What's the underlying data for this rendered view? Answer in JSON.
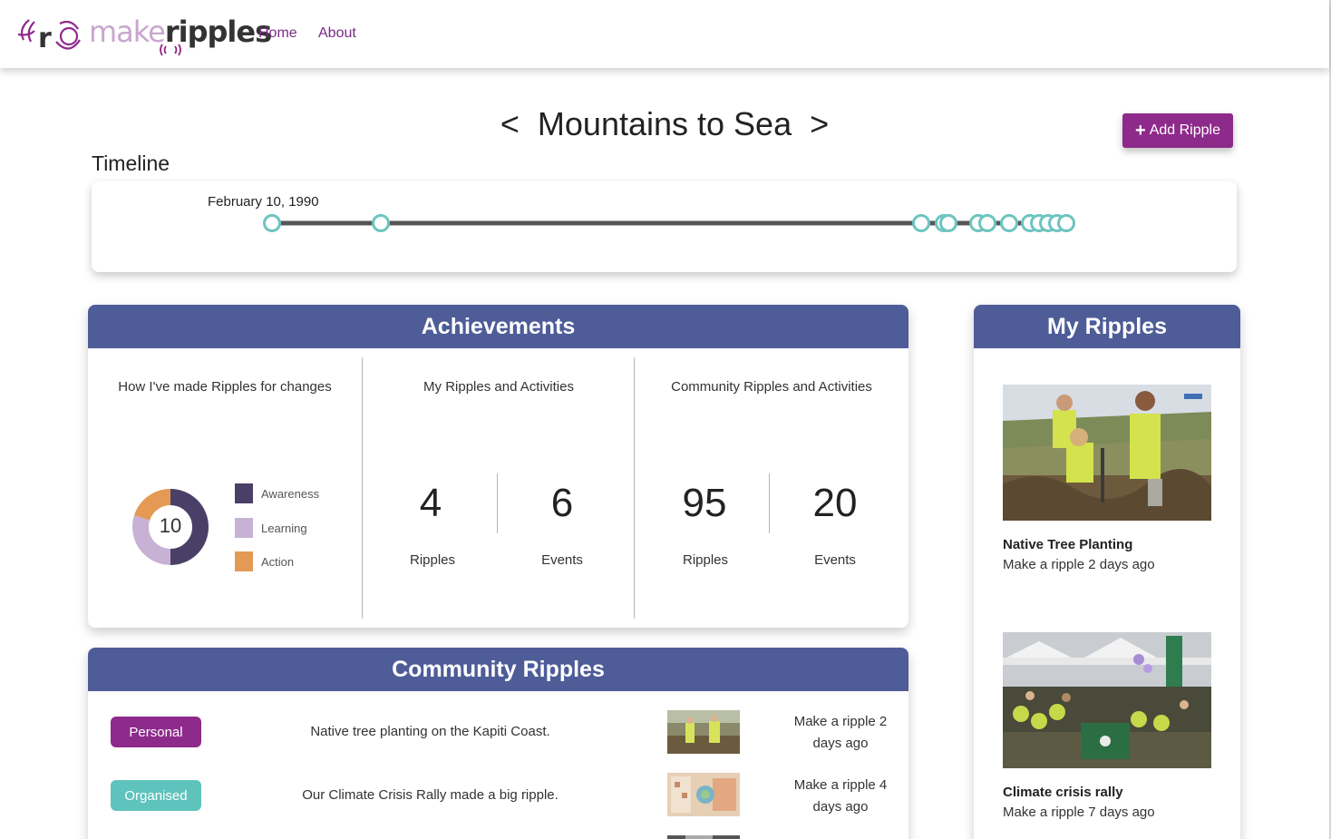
{
  "nav": {
    "logo_make": "make",
    "logo_ripples": "ripples",
    "links": [
      "Home",
      "About"
    ]
  },
  "page": {
    "prev_arrow": "<",
    "title": "Mountains to Sea",
    "next_arrow": ">",
    "add_button": "Add Ripple"
  },
  "timeline": {
    "heading": "Timeline",
    "first_date": "February 10, 1990",
    "event_count": 13
  },
  "achievements": {
    "header": "Achievements",
    "changes": {
      "title": "How I've made Ripples for changes",
      "total": "10",
      "legend": [
        "Awareness",
        "Learning",
        "Action"
      ]
    },
    "mine": {
      "title": "My Ripples and Activities",
      "ripples_value": "4",
      "ripples_label": "Ripples",
      "events_value": "6",
      "events_label": "Events"
    },
    "community": {
      "title": "Community Ripples and Activities",
      "ripples_value": "95",
      "ripples_label": "Ripples",
      "events_value": "20",
      "events_label": "Events"
    }
  },
  "chart_data": {
    "type": "pie",
    "title": "",
    "center_label": "10",
    "categories": [
      "Awareness",
      "Learning",
      "Action"
    ],
    "values": [
      5,
      3,
      2
    ],
    "colors": [
      "#4a3f66",
      "#c7b2d6",
      "#e49a54"
    ]
  },
  "community_ripples": {
    "header": "Community Ripples",
    "rows": [
      {
        "badge": "Personal",
        "badge_color": "#8e2a8b",
        "text": "Native tree planting on the Kapiti Coast.",
        "time_line1": "Make a ripple 2",
        "time_line2": "days ago"
      },
      {
        "badge": "Organised",
        "badge_color": "#5fc3bd",
        "text": "Our Climate Crisis Rally made a big ripple.",
        "time_line1": "Make a ripple 4",
        "time_line2": "days ago"
      }
    ]
  },
  "my_ripples": {
    "header": "My Ripples",
    "items": [
      {
        "title": "Native Tree Planting",
        "subtitle": "Make a ripple 2 days ago"
      },
      {
        "title": "Climate crisis rally",
        "subtitle": "Make a ripple 7 days ago"
      }
    ]
  },
  "colors": {
    "brand_purple": "#8e2a8b",
    "header_blue": "#4e5c98",
    "timeline_teal": "#6cc4bf"
  }
}
